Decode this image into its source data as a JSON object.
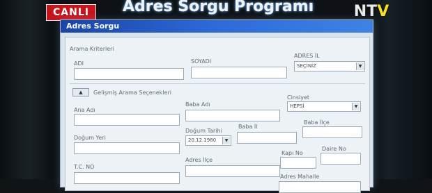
{
  "broadcast": {
    "live_badge": "CANLI",
    "program_title": "Adres Sorgu Programı",
    "channel_logo_left": "N",
    "channel_logo_mid": "T",
    "channel_logo_right": "V"
  },
  "window": {
    "title": "Adres Sorgu"
  },
  "search_criteria": {
    "group_label": "Arama Kriterleri",
    "first_name_label": "ADI",
    "first_name_value": "",
    "last_name_label": "SOYADI",
    "last_name_value": "",
    "address_label": "ADRES İL",
    "address_value": "SEÇİNİZ"
  },
  "advanced": {
    "toggle_label": "▲",
    "section_label": "Gelişmiş Arama Seçenekleri",
    "mother_name_label": "Ana Adı",
    "father_name_label": "Baba Adı",
    "gender_label": "Cinsiyet",
    "gender_value": "HEPSİ",
    "birthplace_label": "Doğum Yeri",
    "birthdate_label": "Doğum Tarihi",
    "birthdate_value": "20.12.1980",
    "father_value_label": "Baba İl",
    "father_district_label": "Baba İlçe",
    "tc_label": "T.C. NO",
    "address_district_label": "Adres İlçe",
    "house_no_label": "Kapı No",
    "apartment_no_label": "Daire No",
    "neighborhood_label": "Adres Mahalle"
  }
}
